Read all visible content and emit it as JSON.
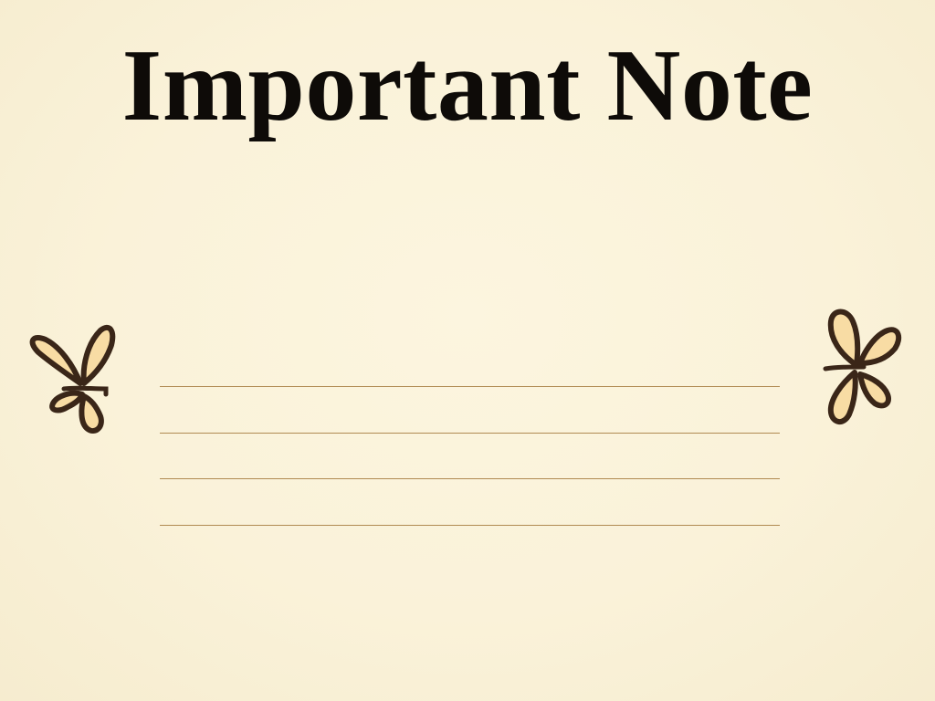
{
  "note": {
    "title": "Important Note",
    "line_count": 4
  },
  "colors": {
    "paper": "#faf2d9",
    "title_ink": "#0e0b08",
    "rule": "#b08a52",
    "ornament_fill": "#f8dca4",
    "ornament_stroke": "#3a2618"
  },
  "icons": {
    "left": "butterfly-icon",
    "right": "butterfly-icon"
  }
}
